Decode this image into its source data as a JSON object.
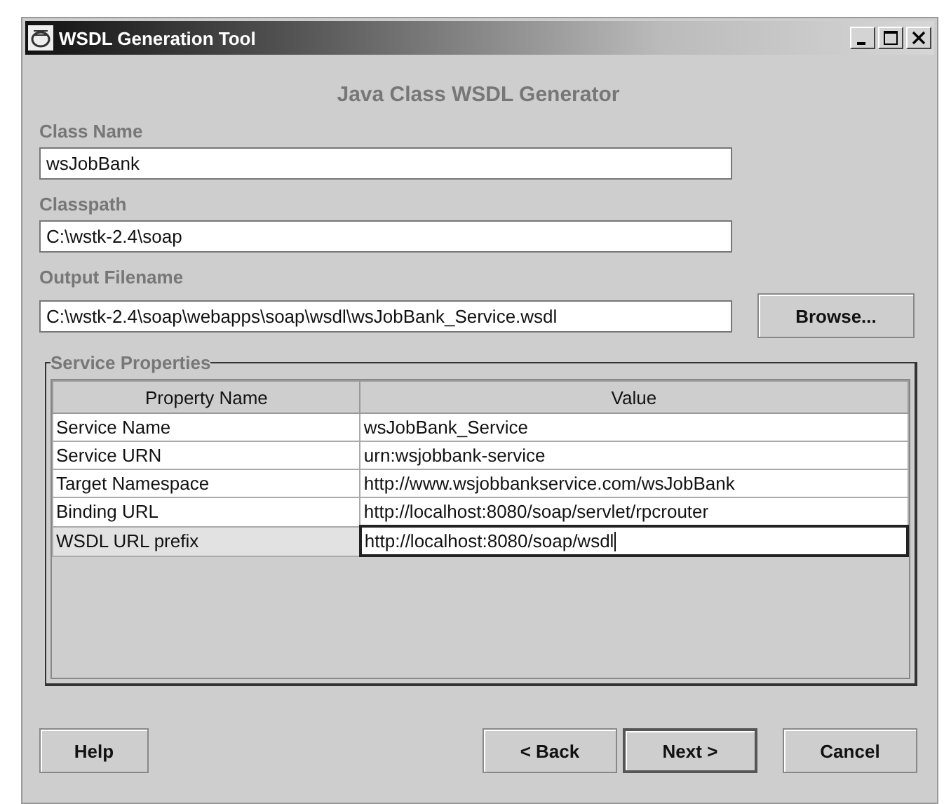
{
  "window": {
    "title": "WSDL Generation Tool"
  },
  "heading": "Java Class WSDL Generator",
  "fields": [
    {
      "label": "Class Name",
      "value": "wsJobBank"
    },
    {
      "label": "Classpath",
      "value": "C:\\wstk-2.4\\soap"
    },
    {
      "label": "Output Filename",
      "value": "C:\\wstk-2.4\\soap\\webapps\\soap\\wsdl\\wsJobBank_Service.wsdl",
      "button": "Browse..."
    }
  ],
  "service_properties": {
    "title": "Service Properties",
    "columns": [
      "Property Name",
      "Value"
    ],
    "rows": [
      {
        "name": "Service Name",
        "value": "wsJobBank_Service",
        "selected": false
      },
      {
        "name": "Service URN",
        "value": "urn:wsjobbank-service",
        "selected": false
      },
      {
        "name": "Target Namespace",
        "value": "http://www.wsjobbankservice.com/wsJobBank",
        "selected": false
      },
      {
        "name": "Binding URL",
        "value": "http://localhost:8080/soap/servlet/rpcrouter",
        "selected": false
      },
      {
        "name": "WSDL URL prefix",
        "value": "http://localhost:8080/soap/wsdl",
        "selected": true
      }
    ]
  },
  "buttons": [
    {
      "label": "Help",
      "default": false
    },
    {
      "label": "< Back",
      "default": false
    },
    {
      "label": "Next >",
      "default": true
    },
    {
      "label": "Cancel",
      "default": false
    }
  ]
}
